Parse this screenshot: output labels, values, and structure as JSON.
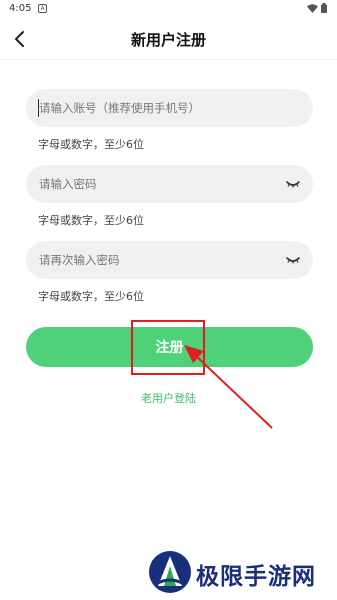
{
  "status_bar": {
    "time": "4:05",
    "notif_icon": "A"
  },
  "nav": {
    "title": "新用户注册"
  },
  "form": {
    "account": {
      "placeholder": "请输入账号（推荐使用手机号）",
      "hint": "字母或数字，至少6位"
    },
    "password": {
      "placeholder": "请输入密码",
      "hint": "字母或数字，至少6位"
    },
    "confirm": {
      "placeholder": "请再次输入密码",
      "hint": "字母或数字，至少6位"
    }
  },
  "register_button": {
    "label": "注册"
  },
  "login_link": {
    "label": "老用户登陆"
  },
  "watermark": {
    "text": "极限手游网"
  },
  "colors": {
    "accent": "#4ed178",
    "link": "#3fbf6a",
    "annotation": "#e02020",
    "watermark": "#1a2f7a"
  }
}
